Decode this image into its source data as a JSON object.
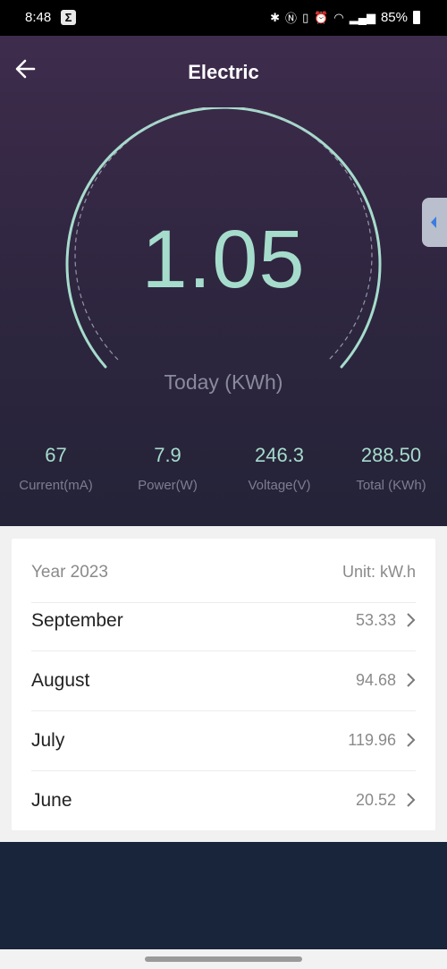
{
  "status_bar": {
    "time": "8:48",
    "battery": "85%",
    "icons": [
      "sigma-icon",
      "bluetooth-icon",
      "nfc-icon",
      "vibrate-icon",
      "alarm-icon",
      "wifi-icon",
      "signal-icon",
      "battery-icon"
    ]
  },
  "header": {
    "title": "Electric"
  },
  "gauge": {
    "value": "1.05",
    "label": "Today (KWh)",
    "color": "#a6dccc"
  },
  "stats": [
    {
      "value": "67",
      "label": "Current(mA)"
    },
    {
      "value": "7.9",
      "label": "Power(W)"
    },
    {
      "value": "246.3",
      "label": "Voltage(V)"
    },
    {
      "value": "288.50",
      "label": "Total (KWh)"
    }
  ],
  "history": {
    "year": "Year 2023",
    "unit": "Unit: kW.h",
    "months": [
      {
        "name": "September",
        "value": "53.33"
      },
      {
        "name": "August",
        "value": "94.68"
      },
      {
        "name": "July",
        "value": "119.96"
      },
      {
        "name": "June",
        "value": "20.52"
      }
    ]
  },
  "colors": {
    "accent": "#a6dccc",
    "header_bg": "#3e2c4c",
    "bottom_bg": "#18253a"
  }
}
